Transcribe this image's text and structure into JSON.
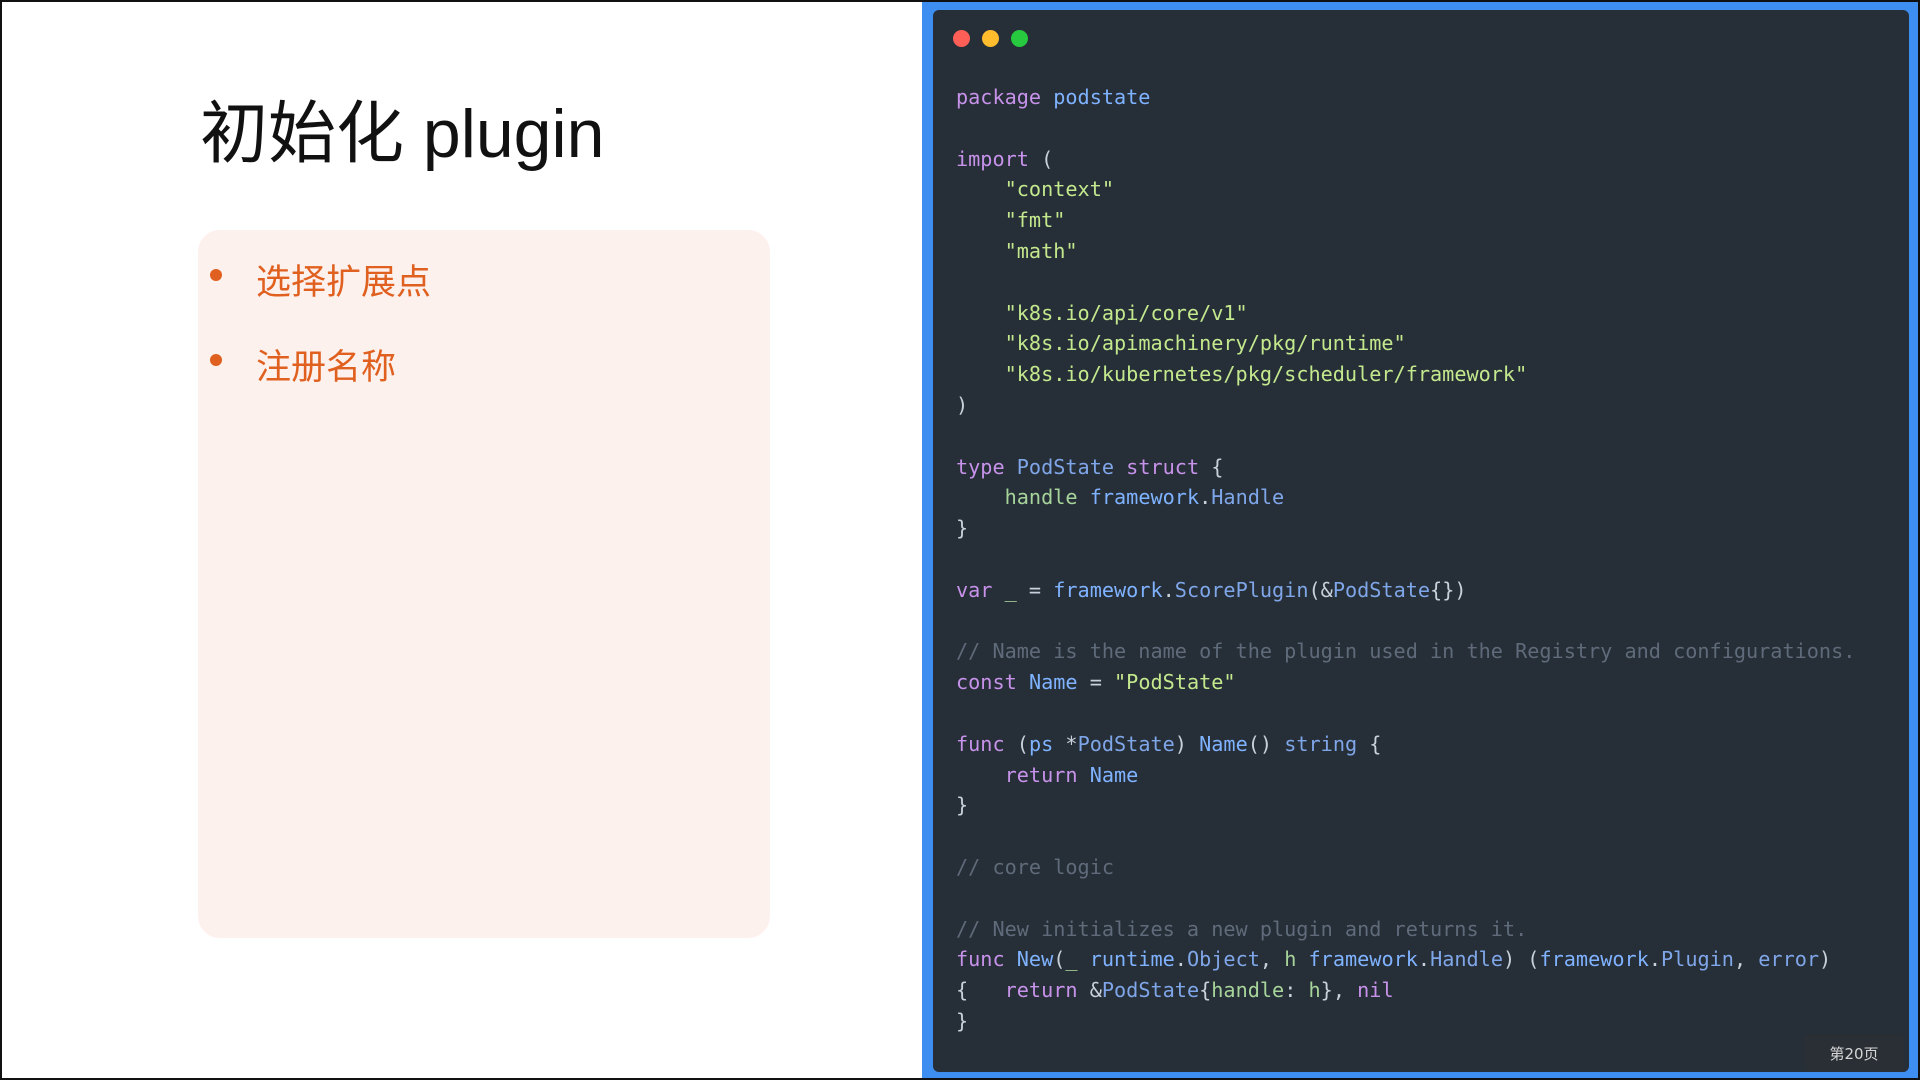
{
  "slide": {
    "title": "初始化 plugin",
    "bullets": [
      "选择扩展点",
      "注册名称"
    ],
    "page_label": "第20页"
  },
  "code_window": {
    "controls": [
      "close",
      "minimize",
      "maximize"
    ],
    "lines": [
      [
        [
          "kw",
          "package"
        ],
        [
          "pl",
          " "
        ],
        [
          "fn",
          "podstate"
        ]
      ],
      [],
      [
        [
          "kw",
          "import"
        ],
        [
          "pl",
          " ("
        ]
      ],
      [
        [
          "pl",
          "    "
        ],
        [
          "st",
          "\"context\""
        ]
      ],
      [
        [
          "pl",
          "    "
        ],
        [
          "st",
          "\"fmt\""
        ]
      ],
      [
        [
          "pl",
          "    "
        ],
        [
          "st",
          "\"math\""
        ]
      ],
      [],
      [
        [
          "pl",
          "    "
        ],
        [
          "st",
          "\"k8s.io/api/core/v1\""
        ]
      ],
      [
        [
          "pl",
          "    "
        ],
        [
          "st",
          "\"k8s.io/apimachinery/pkg/runtime\""
        ]
      ],
      [
        [
          "pl",
          "    "
        ],
        [
          "st",
          "\"k8s.io/kubernetes/pkg/scheduler/framework\""
        ]
      ],
      [
        [
          "pl",
          ")"
        ]
      ],
      [],
      [
        [
          "kw",
          "type"
        ],
        [
          "pl",
          " "
        ],
        [
          "ty",
          "PodState"
        ],
        [
          "pl",
          " "
        ],
        [
          "kw",
          "struct"
        ],
        [
          "pl",
          " {"
        ]
      ],
      [
        [
          "pl",
          "    "
        ],
        [
          "fd",
          "handle"
        ],
        [
          "pl",
          " "
        ],
        [
          "fn",
          "framework"
        ],
        [
          "pl",
          "."
        ],
        [
          "ty",
          "Handle"
        ]
      ],
      [
        [
          "pl",
          "}"
        ]
      ],
      [],
      [
        [
          "kw",
          "var"
        ],
        [
          "pl",
          " "
        ],
        [
          "fd",
          "_"
        ],
        [
          "pl",
          " = "
        ],
        [
          "fn",
          "framework"
        ],
        [
          "pl",
          "."
        ],
        [
          "ty",
          "ScorePlugin"
        ],
        [
          "pl",
          "(&"
        ],
        [
          "ty",
          "PodState"
        ],
        [
          "pl",
          "{})"
        ]
      ],
      [],
      [
        [
          "cm",
          "// Name is the name of the plugin used in the Registry and configurations."
        ]
      ],
      [
        [
          "kw",
          "const"
        ],
        [
          "pl",
          " "
        ],
        [
          "fn",
          "Name"
        ],
        [
          "pl",
          " = "
        ],
        [
          "st",
          "\"PodState\""
        ]
      ],
      [],
      [
        [
          "kw",
          "func"
        ],
        [
          "pl",
          " ("
        ],
        [
          "fn",
          "ps"
        ],
        [
          "pl",
          " *"
        ],
        [
          "ty",
          "PodState"
        ],
        [
          "pl",
          ") "
        ],
        [
          "fn",
          "Name"
        ],
        [
          "pl",
          "() "
        ],
        [
          "ty",
          "string"
        ],
        [
          "pl",
          " {"
        ]
      ],
      [
        [
          "pl",
          "    "
        ],
        [
          "kw",
          "return"
        ],
        [
          "pl",
          " "
        ],
        [
          "fn",
          "Name"
        ]
      ],
      [
        [
          "pl",
          "}"
        ]
      ],
      [],
      [
        [
          "cm",
          "// core logic"
        ]
      ],
      [],
      [
        [
          "cm",
          "// New initializes a new plugin and returns it."
        ]
      ],
      [
        [
          "kw",
          "func"
        ],
        [
          "pl",
          " "
        ],
        [
          "fn",
          "New"
        ],
        [
          "pl",
          "("
        ],
        [
          "fd",
          "_"
        ],
        [
          "pl",
          " "
        ],
        [
          "fn",
          "runtime"
        ],
        [
          "pl",
          "."
        ],
        [
          "ty",
          "Object"
        ],
        [
          "pl",
          ", "
        ],
        [
          "fd",
          "h"
        ],
        [
          "pl",
          " "
        ],
        [
          "fn",
          "framework"
        ],
        [
          "pl",
          "."
        ],
        [
          "ty",
          "Handle"
        ],
        [
          "pl",
          ") ("
        ],
        [
          "fn",
          "framework"
        ],
        [
          "pl",
          "."
        ],
        [
          "ty",
          "Plugin"
        ],
        [
          "pl",
          ", "
        ],
        [
          "ty",
          "error"
        ],
        [
          "pl",
          ")"
        ]
      ],
      [
        [
          "pl",
          "{   "
        ],
        [
          "kw",
          "return"
        ],
        [
          "pl",
          " &"
        ],
        [
          "ty",
          "PodState"
        ],
        [
          "pl",
          "{"
        ],
        [
          "fd",
          "handle"
        ],
        [
          "pl",
          ": "
        ],
        [
          "fd",
          "h"
        ],
        [
          "pl",
          "}, "
        ],
        [
          "kw",
          "nil"
        ]
      ],
      [
        [
          "pl",
          "}"
        ]
      ]
    ]
  },
  "colors": {
    "frame_blue": "#3d8ef0",
    "editor_bg": "#262e37",
    "accent_orange": "#e0601f",
    "bullet_panel_bg": "#fdf1ee",
    "close": "#ff5f56",
    "minimize": "#ffbd2e",
    "maximize": "#27c93f"
  }
}
